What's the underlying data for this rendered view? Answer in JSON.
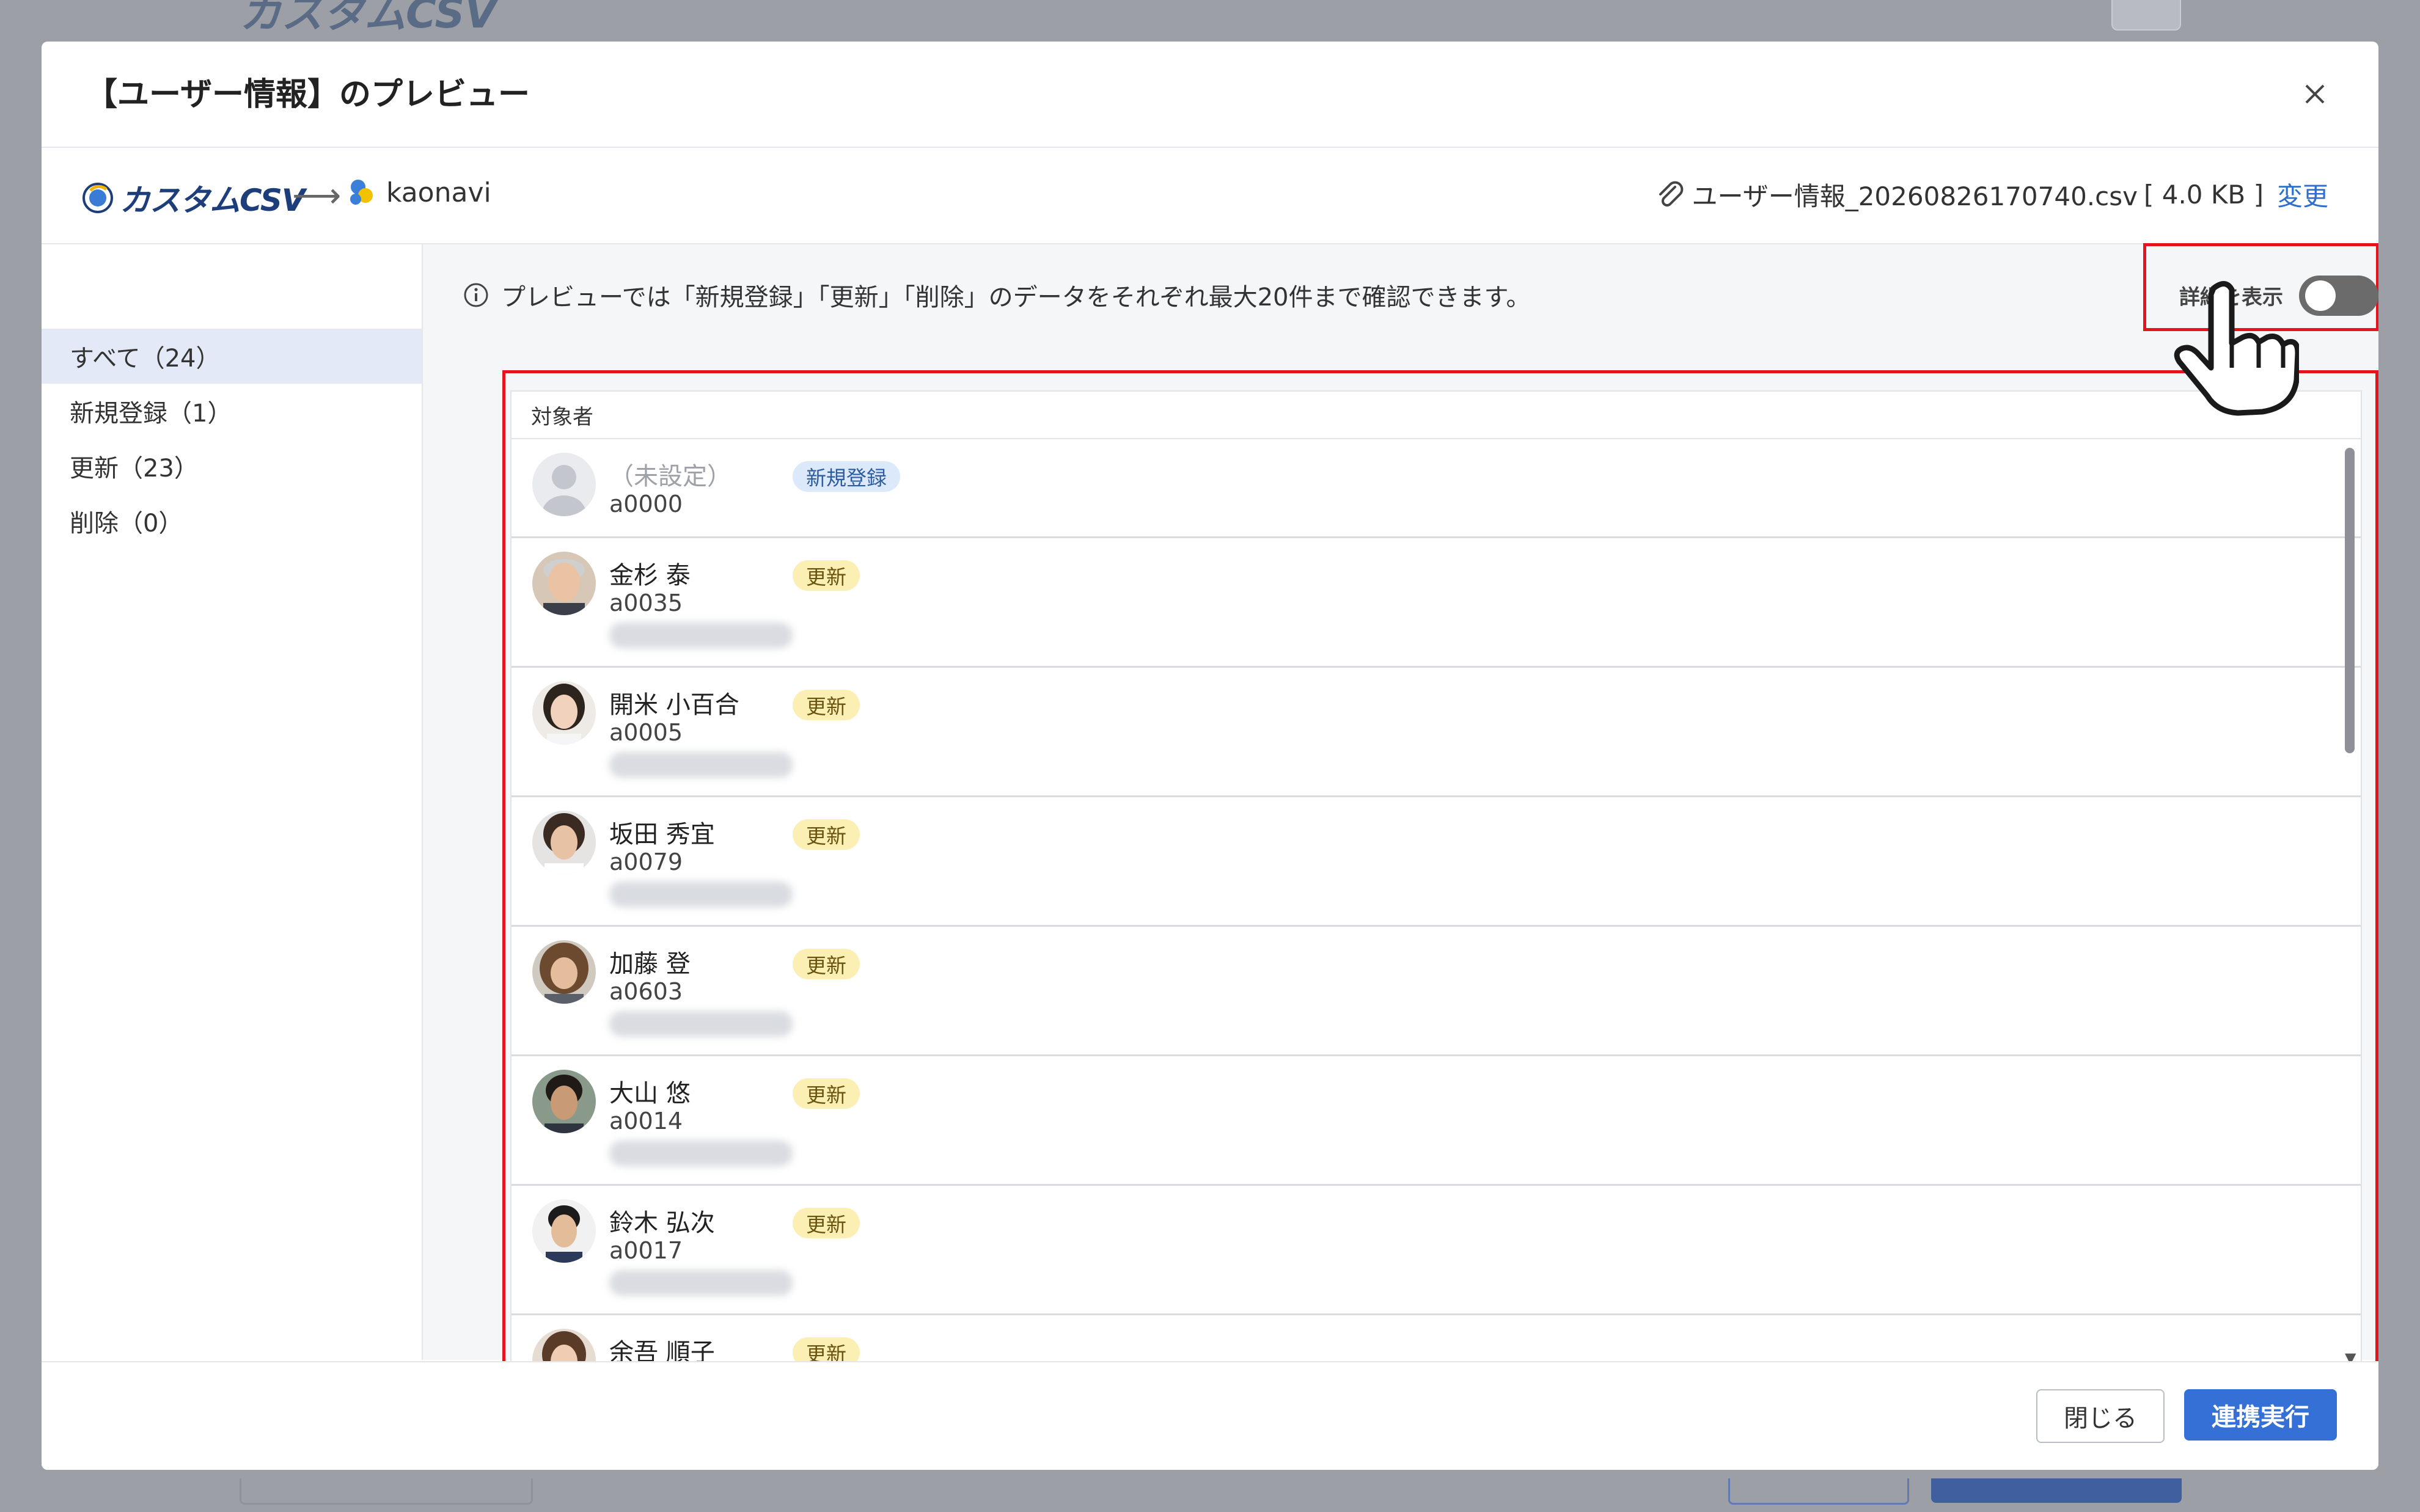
{
  "background": {
    "app_logo": "カスタムCSV"
  },
  "modal": {
    "title": "【ユーザー情報】のプレビュー",
    "close_icon": "close-icon"
  },
  "source_bar": {
    "source_name": "カスタムCSV",
    "destination_name": "kaonavi",
    "file_name": "ユーザー情報_20260826170740.csv",
    "file_size": "[ 4.0 KB ]",
    "change_label": "変更"
  },
  "filters": [
    {
      "label": "すべて（24）",
      "active": true
    },
    {
      "label": "新規登録（1）",
      "active": false
    },
    {
      "label": "更新（23）",
      "active": false
    },
    {
      "label": "削除（0）",
      "active": false
    }
  ],
  "info": {
    "message": "プレビューでは「新規登録」「更新」「削除」のデータをそれぞれ最大20件まで確認できます。",
    "detail_toggle_label": "詳細を表示",
    "detail_toggle_on": false
  },
  "table": {
    "column_header": "対象者",
    "rows": [
      {
        "name": "（未設定）",
        "id": "a0000",
        "status": "新規登録",
        "placeholder": true
      },
      {
        "name": "金杉 泰",
        "id": "a0035",
        "status": "更新"
      },
      {
        "name": "開米 小百合",
        "id": "a0005",
        "status": "更新"
      },
      {
        "name": "坂田 秀宜",
        "id": "a0079",
        "status": "更新"
      },
      {
        "name": "加藤 登",
        "id": "a0603",
        "status": "更新"
      },
      {
        "name": "大山 悠",
        "id": "a0014",
        "status": "更新"
      },
      {
        "name": "鈴木 弘次",
        "id": "a0017",
        "status": "更新"
      },
      {
        "name": "余吾 順子",
        "id": "",
        "status": "更新"
      }
    ]
  },
  "footer": {
    "close_label": "閉じる",
    "run_label": "連携実行"
  },
  "colors": {
    "accent": "#3470d6",
    "highlight": "#e5141c",
    "badge_new": "#dbe9fa",
    "badge_update": "#fbefb4"
  }
}
